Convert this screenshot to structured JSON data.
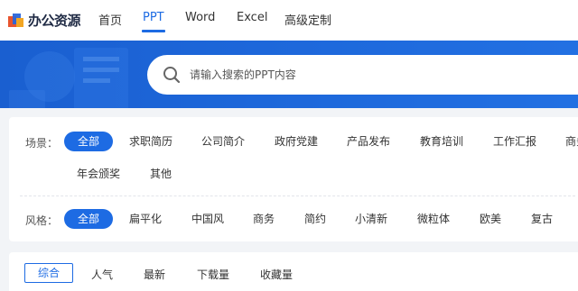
{
  "header": {
    "logo_text": "办公资源",
    "nav": [
      {
        "label": "首页",
        "active": false
      },
      {
        "label": "PPT",
        "active": true
      },
      {
        "label": "Word",
        "active": false
      },
      {
        "label": "Excel",
        "active": false
      },
      {
        "label": "高级定制",
        "active": false
      }
    ]
  },
  "search": {
    "placeholder": "请输入搜索的PPT内容"
  },
  "filters": {
    "scene": {
      "label": "场景：",
      "options": [
        "全部",
        "求职简历",
        "公司简介",
        "政府党建",
        "产品发布",
        "教育培训",
        "工作汇报",
        "商务",
        "年会颁奖",
        "其他"
      ],
      "selected": "全部"
    },
    "style": {
      "label": "风格：",
      "options": [
        "全部",
        "扁平化",
        "中国风",
        "商务",
        "简约",
        "小清新",
        "微粒体",
        "欧美",
        "复古"
      ],
      "selected": "全部"
    }
  },
  "sort": {
    "options": [
      "综合",
      "人气",
      "最新",
      "下载量",
      "收藏量"
    ],
    "selected": "综合"
  },
  "colors": {
    "accent": "#1d6be3",
    "banner": "#1d67da",
    "background": "#f2f4f7"
  }
}
